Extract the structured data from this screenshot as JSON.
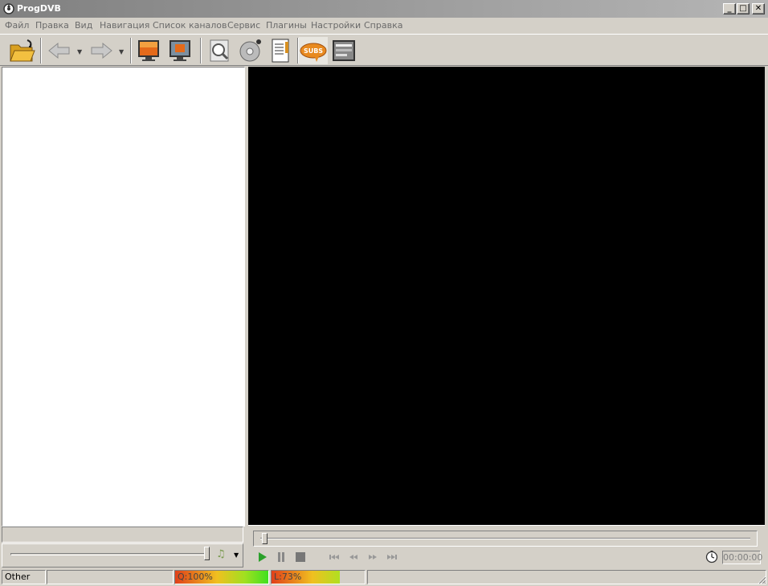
{
  "window": {
    "title": "ProgDVB"
  },
  "window_controls": {
    "minimize": "_",
    "maximize": "□",
    "close": "✕"
  },
  "menu": [
    {
      "label": "Файл"
    },
    {
      "label": "Правка"
    },
    {
      "label": "Вид"
    },
    {
      "label": "Навигация"
    },
    {
      "label": "Список каналов"
    },
    {
      "label": "Сервис"
    },
    {
      "label": "Плагины"
    },
    {
      "label": "Настройки"
    },
    {
      "label": "Справка"
    }
  ],
  "toolbar": {
    "icons": [
      "open-folder-icon",
      "back-arrow-icon",
      "forward-arrow-icon",
      "monitor-fullscreen-icon",
      "monitor-window-icon",
      "search-scan-icon",
      "record-disc-icon",
      "notepad-icon",
      "subtitles-icon",
      "teletext-icon"
    ],
    "subs_label": "SUBS"
  },
  "transport": {
    "time": "00:00:00",
    "icons": [
      "play-icon",
      "pause-icon",
      "stop-icon",
      "skip-back-icon",
      "rewind-icon",
      "fast-forward-icon",
      "skip-forward-icon",
      "clock-icon"
    ]
  },
  "audio": {
    "icon": "audio-track-icon"
  },
  "status": {
    "channel_type": "Other",
    "quality": {
      "label": "Q:100%",
      "value": 100
    },
    "level": {
      "label": "L:73%",
      "value": 73
    }
  },
  "colors": {
    "titlebar_start": "#808080",
    "titlebar_end": "#b5b5b5",
    "window_bg": "#d4d0c8",
    "video_bg": "#000000",
    "play_green": "#2aa02a"
  }
}
